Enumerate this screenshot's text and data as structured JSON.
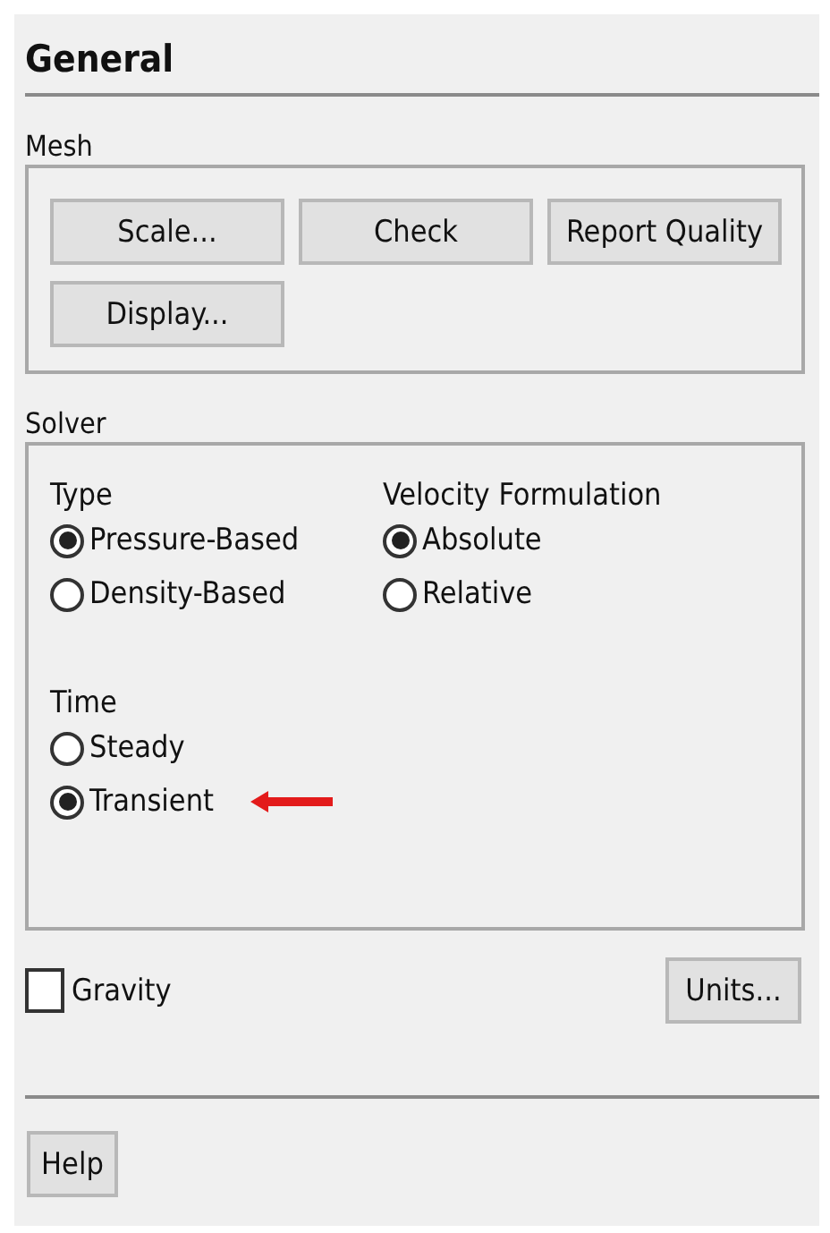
{
  "title": "General",
  "mesh": {
    "label": "Mesh",
    "buttons": [
      "Scale...",
      "Check",
      "Report Quality",
      "Display..."
    ]
  },
  "solver": {
    "label": "Solver",
    "groups": [
      {
        "label": "Type",
        "options": [
          {
            "label": "Pressure-Based",
            "selected": true
          },
          {
            "label": "Density-Based",
            "selected": false
          }
        ]
      },
      {
        "label": "Velocity Formulation",
        "options": [
          {
            "label": "Absolute",
            "selected": true
          },
          {
            "label": "Relative",
            "selected": false
          }
        ]
      },
      {
        "label": "Time",
        "options": [
          {
            "label": "Steady",
            "selected": false
          },
          {
            "label": "Transient",
            "selected": true,
            "pointer": true
          }
        ]
      }
    ]
  },
  "gravity": {
    "label": "Gravity",
    "checked": false
  },
  "units_button": "Units...",
  "help_button": "Help"
}
